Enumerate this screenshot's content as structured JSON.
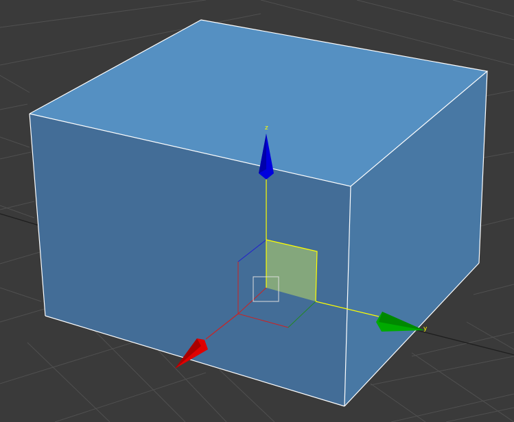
{
  "viewport": {
    "background_color": "#3a3a3a",
    "grid_color": "#505050",
    "grid_dark_line_color": "#1e1e1e"
  },
  "box": {
    "top_color": "#5590c2",
    "front_color": "#436d97",
    "side_color": "#4878a4",
    "edge_color": "#ffffff"
  },
  "gizmo": {
    "x_axis": {
      "label": "",
      "color": "#e00000",
      "icon": "cone-arrow-x-icon"
    },
    "y_axis": {
      "label": "y",
      "color": "#00aa00",
      "icon": "cone-arrow-y-icon"
    },
    "z_axis": {
      "label": "z",
      "color": "#0000dd",
      "icon": "cone-arrow-z-icon"
    },
    "highlight_color": "#ffff00",
    "plane_fill": "#a0c070",
    "center_box_color": "#dddddd"
  }
}
